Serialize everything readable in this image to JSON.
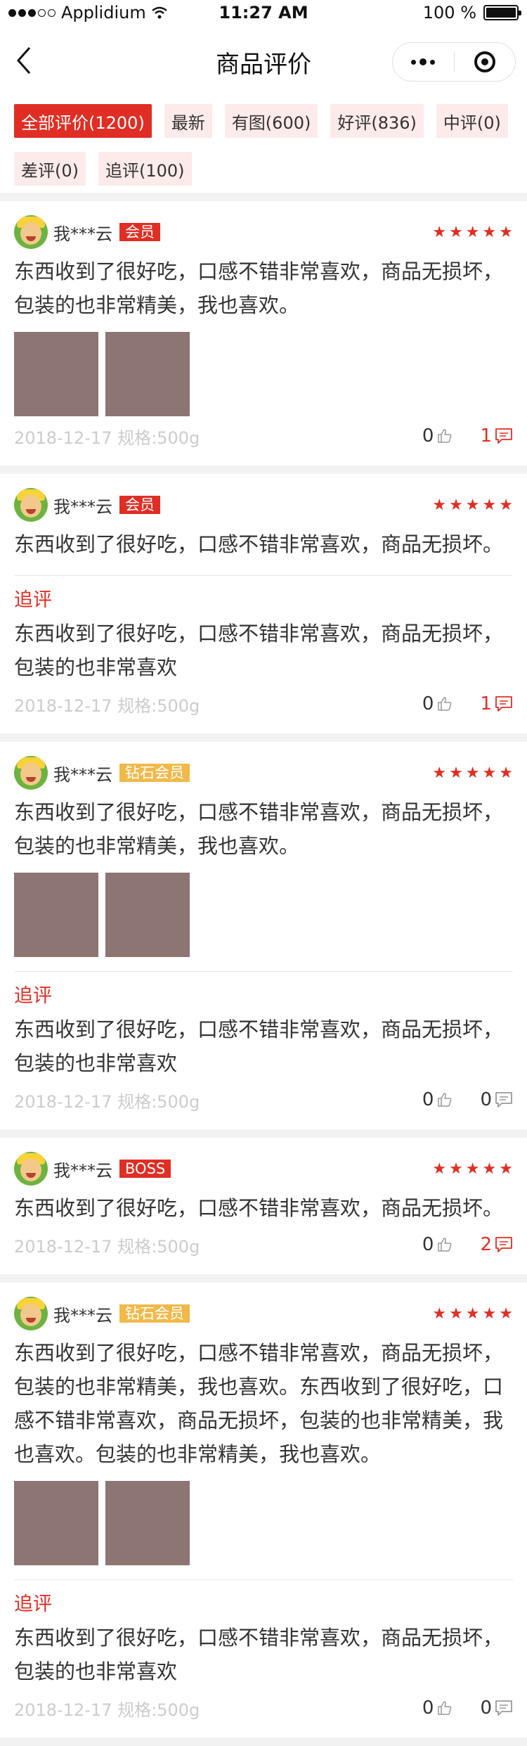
{
  "status_bar": {
    "carrier": "Applidium",
    "time": "11:27 AM",
    "battery": "100 %"
  },
  "nav": {
    "title": "商品评价"
  },
  "filters": [
    {
      "label": "全部评价(1200)",
      "active": true
    },
    {
      "label": "最新",
      "active": false
    },
    {
      "label": "有图(600)",
      "active": false
    },
    {
      "label": "好评(836)",
      "active": false
    },
    {
      "label": "中评(0)",
      "active": false
    },
    {
      "label": "差评(0)",
      "active": false
    },
    {
      "label": "追评(100)",
      "active": false
    }
  ],
  "follow_label": "追评",
  "reviews": [
    {
      "user": "我***云",
      "badge": "会员",
      "badge_color": "#e02e24",
      "text": "东西收到了很好吃，口感不错非常喜欢，商品无损坏，包装的也非常精美，我也喜欢。",
      "photo_count": 2,
      "follow_text": "",
      "meta": "2018-12-17 规格:500g",
      "likes": "0",
      "comments": "1",
      "comments_active": true
    },
    {
      "user": "我***云",
      "badge": "会员",
      "badge_color": "#e02e24",
      "text": "东西收到了很好吃，口感不错非常喜欢，商品无损坏。",
      "photo_count": 0,
      "follow_text": "东西收到了很好吃，口感不错非常喜欢，商品无损坏，包装的也非常喜欢",
      "meta": "2018-12-17 规格:500g",
      "likes": "0",
      "comments": "1",
      "comments_active": true
    },
    {
      "user": "我***云",
      "badge": "钻石会员",
      "badge_color": "#f0b94a",
      "text": "东西收到了很好吃，口感不错非常喜欢，商品无损坏，包装的也非常精美，我也喜欢。",
      "photo_count": 2,
      "follow_text": "东西收到了很好吃，口感不错非常喜欢，商品无损坏，包装的也非常喜欢",
      "meta": "2018-12-17 规格:500g",
      "likes": "0",
      "comments": "0",
      "comments_active": false
    },
    {
      "user": "我***云",
      "badge": "BOSS",
      "badge_color": "#e02e24",
      "text": "东西收到了很好吃，口感不错非常喜欢，商品无损坏。",
      "photo_count": 0,
      "follow_text": "",
      "meta": "2018-12-17 规格:500g",
      "likes": "0",
      "comments": "2",
      "comments_active": true
    },
    {
      "user": "我***云",
      "badge": "钻石会员",
      "badge_color": "#f0b94a",
      "text": "东西收到了很好吃，口感不错非常喜欢，商品无损坏，包装的也非常精美，我也喜欢。东西收到了很好吃，口感不错非常喜欢，商品无损坏，包装的也非常精美，我也喜欢。包装的也非常精美，我也喜欢。",
      "photo_count": 2,
      "follow_text": "东西收到了很好吃，口感不错非常喜欢，商品无损坏，包装的也非常喜欢",
      "meta": "2018-12-17 规格:500g",
      "likes": "0",
      "comments": "0",
      "comments_active": false
    }
  ]
}
